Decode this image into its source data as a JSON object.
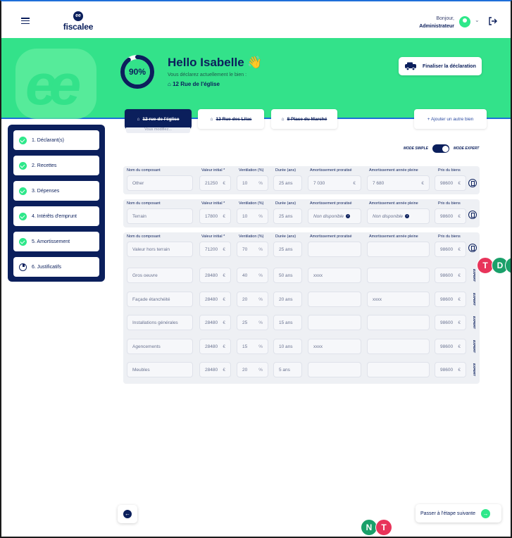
{
  "header": {
    "logo_text": "fiscalee",
    "logo_mark": "ee",
    "greeting": "Bonjour,",
    "user_role": "Administrateur"
  },
  "hero": {
    "progress_label": "90%",
    "progress_value": 0.9,
    "hello": "Hello Isabelle",
    "wave_emoji": "👋",
    "declaring_text": "Vous déclarez actuellement le bien :",
    "address": "12 Rue de l'église",
    "finalize_label": "Finaliser la déclaration"
  },
  "property_tabs": {
    "tab1": "12 rue de l'église",
    "tab1_sub": "Vous modifiez...",
    "tab2": "12 Rue des Lilas",
    "tab3": "8 Place du Marché",
    "add": "+ Ajouter un autre bien"
  },
  "steps": [
    {
      "label": "1. Déclarant(s)",
      "icon": "check-icon"
    },
    {
      "label": "2. Recettes",
      "icon": "check-icon"
    },
    {
      "label": "3. Dépenses",
      "icon": "check-icon"
    },
    {
      "label": "4. Intérêts d'emprunt",
      "icon": "check-icon"
    },
    {
      "label": "5. Amortissement",
      "icon": "check-icon"
    },
    {
      "label": "6. Justificatifs",
      "icon": "pie-chart-icon"
    }
  ],
  "mode": {
    "simple": "MODE SIMPLE",
    "expert": "MODE EXPERT"
  },
  "columns": {
    "name": "Nom du composant",
    "initial": "Valeur initial *",
    "ventilation": "Ventilation (%)",
    "duration": "Durée (ans)",
    "prorated": "Amortissement proratisé",
    "full_year": "Amortissement année pleine",
    "price": "Prix du biens"
  },
  "units": {
    "euro": "€",
    "percent": "%"
  },
  "components": [
    {
      "name": "Other",
      "initial": "21250",
      "ventilation": "10",
      "duration": "25 ans",
      "prorated": "7 030",
      "full_year": "7 680",
      "price": "98600"
    },
    {
      "name": "Terrain",
      "initial": "17800",
      "ventilation": "10",
      "duration": "25 ans",
      "prorated": "Non disponible",
      "full_year": "Non disponible",
      "price": "98600"
    }
  ],
  "composite": {
    "name": "Valeur hors terrain",
    "initial": "71200",
    "ventilation": "70",
    "duration": "25 ans",
    "price": "98600",
    "expert_label": "EXPERT",
    "subs": [
      {
        "name": "Gros oeuvre",
        "initial": "28480",
        "ventilation": "40",
        "duration": "50 ans",
        "prorated": "xxxx",
        "full_year": "",
        "price": "98600"
      },
      {
        "name": "Façade étanchéité",
        "initial": "28480",
        "ventilation": "20",
        "duration": "20 ans",
        "prorated": "",
        "full_year": "xxxx",
        "price": "98600"
      },
      {
        "name": "Installations générales",
        "initial": "28480",
        "ventilation": "25",
        "duration": "15 ans",
        "prorated": "",
        "full_year": "",
        "price": "98600"
      },
      {
        "name": "Agencements",
        "initial": "28480",
        "ventilation": "15",
        "duration": "10 ans",
        "prorated": "xxxx",
        "full_year": "",
        "price": "98600"
      },
      {
        "name": "Meubles",
        "initial": "28480",
        "ventilation": "20",
        "duration": "5 ans",
        "prorated": "",
        "full_year": "",
        "price": "98600"
      }
    ]
  },
  "presence": [
    {
      "letter": "T",
      "color": "#e8345a"
    },
    {
      "letter": "D",
      "color": "#1aa06a"
    },
    {
      "letter": "N",
      "color": "#1aa06a"
    },
    {
      "letter": "N",
      "color": "#1aa06a"
    },
    {
      "letter": "T",
      "color": "#e8345a"
    }
  ],
  "nav": {
    "back_icon": "arrow-left-icon",
    "next_label": "Passer à l'étape suivante"
  },
  "colors": {
    "navy": "#0b1f5c",
    "green": "#33e28a",
    "accent_blue": "#1e6fd9"
  }
}
